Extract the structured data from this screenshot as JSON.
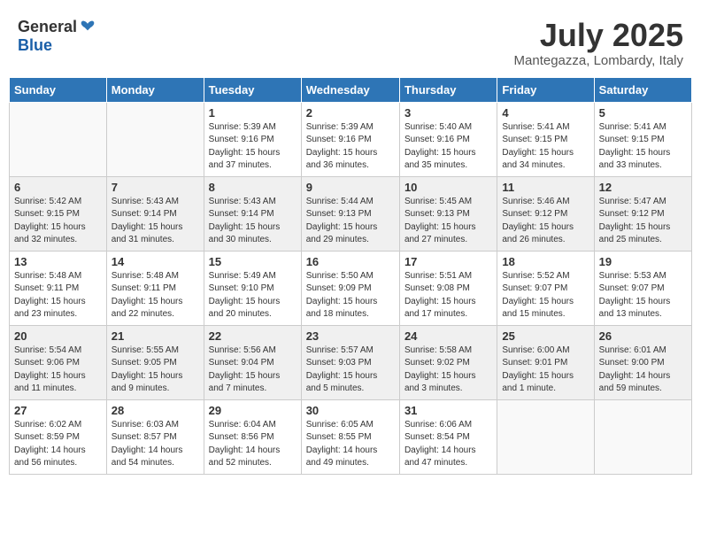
{
  "header": {
    "logo_general": "General",
    "logo_blue": "Blue",
    "month_title": "July 2025",
    "subtitle": "Mantegazza, Lombardy, Italy"
  },
  "days_of_week": [
    "Sunday",
    "Monday",
    "Tuesday",
    "Wednesday",
    "Thursday",
    "Friday",
    "Saturday"
  ],
  "weeks": [
    [
      {
        "day": "",
        "info": ""
      },
      {
        "day": "",
        "info": ""
      },
      {
        "day": "1",
        "info": "Sunrise: 5:39 AM\nSunset: 9:16 PM\nDaylight: 15 hours\nand 37 minutes."
      },
      {
        "day": "2",
        "info": "Sunrise: 5:39 AM\nSunset: 9:16 PM\nDaylight: 15 hours\nand 36 minutes."
      },
      {
        "day": "3",
        "info": "Sunrise: 5:40 AM\nSunset: 9:16 PM\nDaylight: 15 hours\nand 35 minutes."
      },
      {
        "day": "4",
        "info": "Sunrise: 5:41 AM\nSunset: 9:15 PM\nDaylight: 15 hours\nand 34 minutes."
      },
      {
        "day": "5",
        "info": "Sunrise: 5:41 AM\nSunset: 9:15 PM\nDaylight: 15 hours\nand 33 minutes."
      }
    ],
    [
      {
        "day": "6",
        "info": "Sunrise: 5:42 AM\nSunset: 9:15 PM\nDaylight: 15 hours\nand 32 minutes."
      },
      {
        "day": "7",
        "info": "Sunrise: 5:43 AM\nSunset: 9:14 PM\nDaylight: 15 hours\nand 31 minutes."
      },
      {
        "day": "8",
        "info": "Sunrise: 5:43 AM\nSunset: 9:14 PM\nDaylight: 15 hours\nand 30 minutes."
      },
      {
        "day": "9",
        "info": "Sunrise: 5:44 AM\nSunset: 9:13 PM\nDaylight: 15 hours\nand 29 minutes."
      },
      {
        "day": "10",
        "info": "Sunrise: 5:45 AM\nSunset: 9:13 PM\nDaylight: 15 hours\nand 27 minutes."
      },
      {
        "day": "11",
        "info": "Sunrise: 5:46 AM\nSunset: 9:12 PM\nDaylight: 15 hours\nand 26 minutes."
      },
      {
        "day": "12",
        "info": "Sunrise: 5:47 AM\nSunset: 9:12 PM\nDaylight: 15 hours\nand 25 minutes."
      }
    ],
    [
      {
        "day": "13",
        "info": "Sunrise: 5:48 AM\nSunset: 9:11 PM\nDaylight: 15 hours\nand 23 minutes."
      },
      {
        "day": "14",
        "info": "Sunrise: 5:48 AM\nSunset: 9:11 PM\nDaylight: 15 hours\nand 22 minutes."
      },
      {
        "day": "15",
        "info": "Sunrise: 5:49 AM\nSunset: 9:10 PM\nDaylight: 15 hours\nand 20 minutes."
      },
      {
        "day": "16",
        "info": "Sunrise: 5:50 AM\nSunset: 9:09 PM\nDaylight: 15 hours\nand 18 minutes."
      },
      {
        "day": "17",
        "info": "Sunrise: 5:51 AM\nSunset: 9:08 PM\nDaylight: 15 hours\nand 17 minutes."
      },
      {
        "day": "18",
        "info": "Sunrise: 5:52 AM\nSunset: 9:07 PM\nDaylight: 15 hours\nand 15 minutes."
      },
      {
        "day": "19",
        "info": "Sunrise: 5:53 AM\nSunset: 9:07 PM\nDaylight: 15 hours\nand 13 minutes."
      }
    ],
    [
      {
        "day": "20",
        "info": "Sunrise: 5:54 AM\nSunset: 9:06 PM\nDaylight: 15 hours\nand 11 minutes."
      },
      {
        "day": "21",
        "info": "Sunrise: 5:55 AM\nSunset: 9:05 PM\nDaylight: 15 hours\nand 9 minutes."
      },
      {
        "day": "22",
        "info": "Sunrise: 5:56 AM\nSunset: 9:04 PM\nDaylight: 15 hours\nand 7 minutes."
      },
      {
        "day": "23",
        "info": "Sunrise: 5:57 AM\nSunset: 9:03 PM\nDaylight: 15 hours\nand 5 minutes."
      },
      {
        "day": "24",
        "info": "Sunrise: 5:58 AM\nSunset: 9:02 PM\nDaylight: 15 hours\nand 3 minutes."
      },
      {
        "day": "25",
        "info": "Sunrise: 6:00 AM\nSunset: 9:01 PM\nDaylight: 15 hours\nand 1 minute."
      },
      {
        "day": "26",
        "info": "Sunrise: 6:01 AM\nSunset: 9:00 PM\nDaylight: 14 hours\nand 59 minutes."
      }
    ],
    [
      {
        "day": "27",
        "info": "Sunrise: 6:02 AM\nSunset: 8:59 PM\nDaylight: 14 hours\nand 56 minutes."
      },
      {
        "day": "28",
        "info": "Sunrise: 6:03 AM\nSunset: 8:57 PM\nDaylight: 14 hours\nand 54 minutes."
      },
      {
        "day": "29",
        "info": "Sunrise: 6:04 AM\nSunset: 8:56 PM\nDaylight: 14 hours\nand 52 minutes."
      },
      {
        "day": "30",
        "info": "Sunrise: 6:05 AM\nSunset: 8:55 PM\nDaylight: 14 hours\nand 49 minutes."
      },
      {
        "day": "31",
        "info": "Sunrise: 6:06 AM\nSunset: 8:54 PM\nDaylight: 14 hours\nand 47 minutes."
      },
      {
        "day": "",
        "info": ""
      },
      {
        "day": "",
        "info": ""
      }
    ]
  ]
}
